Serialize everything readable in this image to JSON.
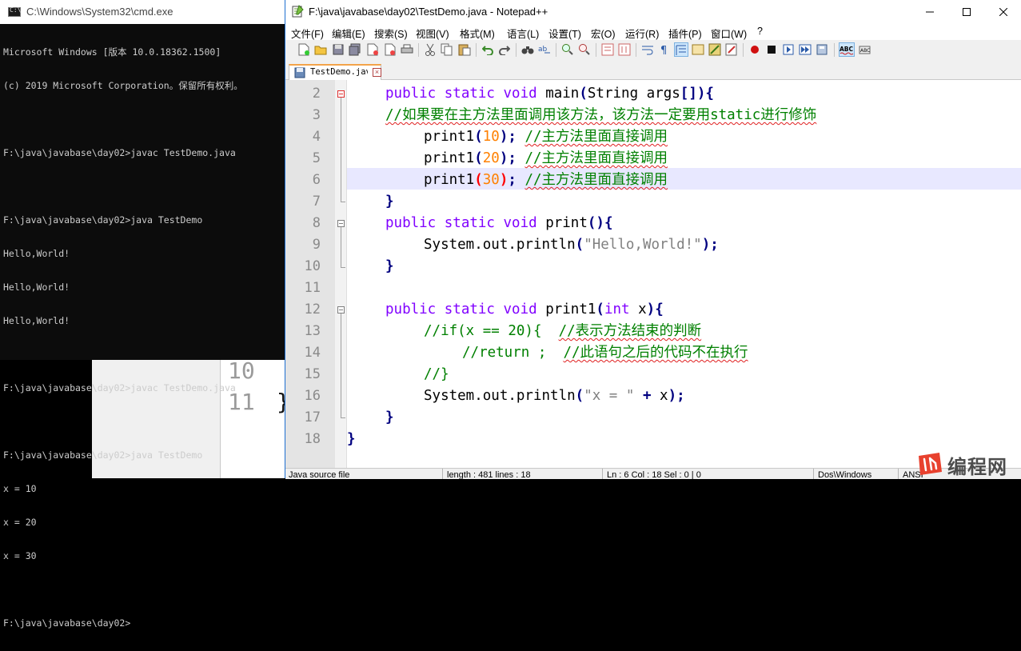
{
  "cmd": {
    "title": "C:\\Windows\\System32\\cmd.exe",
    "lines": [
      "Microsoft Windows [版本 10.0.18362.1500]",
      "(c) 2019 Microsoft Corporation。保留所有权利。",
      "",
      "F:\\java\\javabase\\day02>javac TestDemo.java",
      "",
      "F:\\java\\javabase\\day02>java TestDemo",
      "Hello,World!",
      "Hello,World!",
      "Hello,World!",
      "",
      "F:\\java\\javabase\\day02>javac TestDemo.java",
      "",
      "F:\\java\\javabase\\day02>java TestDemo",
      "x = 10",
      "x = 20",
      "x = 30",
      "",
      "F:\\java\\javabase\\day02>"
    ]
  },
  "background_editor": {
    "line_numbers": [
      "10",
      "11"
    ],
    "brace": "}"
  },
  "npp": {
    "title": "F:\\java\\javabase\\day02\\TestDemo.java - Notepad++",
    "menu": [
      "文件(F)",
      "编辑(E)",
      "搜索(S)",
      "视图(V)",
      "格式(M)",
      "语言(L)",
      "设置(T)",
      "宏(O)",
      "运行(R)",
      "插件(P)",
      "窗口(W)",
      "?"
    ],
    "tab_label": "TestDemo.java",
    "line_numbers": [
      "2",
      "3",
      "4",
      "5",
      "6",
      "7",
      "8",
      "9",
      "10",
      "11",
      "12",
      "13",
      "14",
      "15",
      "16",
      "17",
      "18"
    ],
    "code": {
      "l2_kw": "public static void",
      "l2_rest": " main",
      "l2_paren_open": "(",
      "l2_type": "String args",
      "l2_brackets": "[])",
      "l2_brace": "{",
      "l3_comment": "//如果要在主方法里面调用该方法，该方法一定要用static进行修饰",
      "l4_call": "print1",
      "l4_arg": "10",
      "l4_comment": "//主方法里面直接调用",
      "l5_call": "print1",
      "l5_arg": "20",
      "l5_comment": "//主方法里面直接调用",
      "l6_call": "print1",
      "l6_arg": "30",
      "l6_comment": "//主方法里面直接调用",
      "l7": "}",
      "l8_kw": "public static void",
      "l8_rest": " print",
      "l8_tail": "(){",
      "l9_call": "System.out.println",
      "l9_str": "\"Hello,World!\"",
      "l10": "}",
      "l12_kw": "public static void",
      "l12_rest": " print1",
      "l12_p1": "(",
      "l12_int": "int",
      "l12_x": " x",
      "l12_tail": "){",
      "l13_comment_code": "//if(x == 20){  ",
      "l13_comment_cn": "//表示方法结束的判断",
      "l14_comment_code": "//return ;  ",
      "l14_comment_cn": "//此语句之后的代码不在执行",
      "l15_comment": "//}",
      "l16_call": "System.out.println",
      "l16_str": "\"x = \"",
      "l16_plus": " + ",
      "l16_x": "x",
      "l17": "}",
      "l18": "}"
    },
    "status": {
      "type": "Java source file",
      "length": "length : 481    lines : 18",
      "pos": "Ln : 6    Col : 18    Sel : 0 | 0",
      "eol": "Dos\\Windows",
      "enc": "ANSI"
    }
  },
  "watermark": {
    "text": "编程网"
  },
  "colors": {
    "keyword": "#8000ff",
    "string": "#808080",
    "number": "#ff8000",
    "comment": "#008000",
    "operator": "#000080",
    "current_line": "#e8e8ff",
    "cmd_bg": "#0c0c0c",
    "cmd_fg": "#cccccc"
  }
}
